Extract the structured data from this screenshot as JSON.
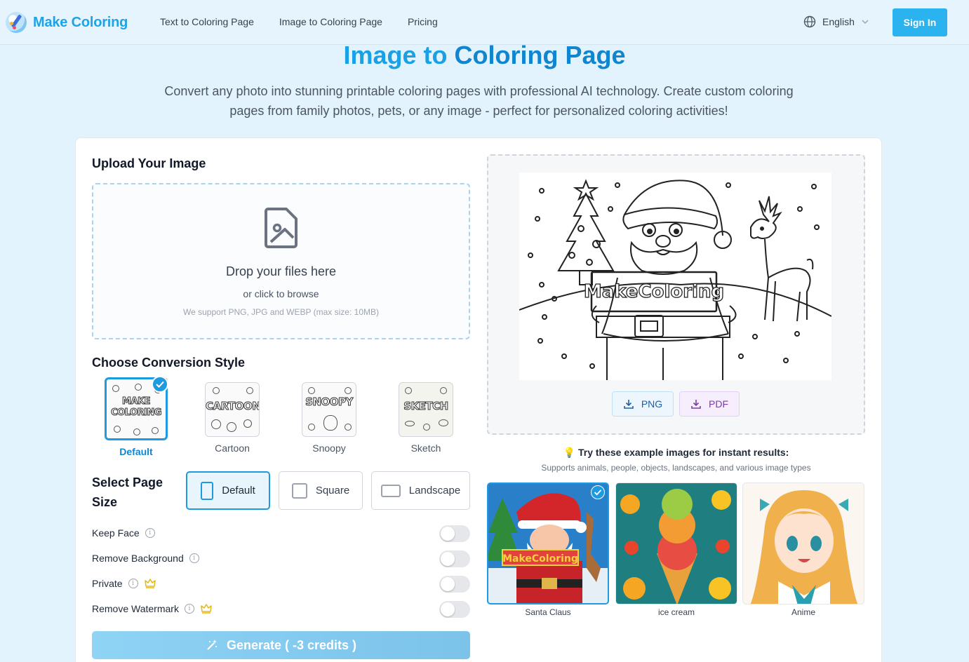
{
  "header": {
    "brand": "Make Coloring",
    "nav": [
      "Text to Coloring Page",
      "Image to Coloring Page",
      "Pricing"
    ],
    "language": "English",
    "sign_in": "Sign In"
  },
  "hero": {
    "title_part1": "Image to",
    "title_part2": "Coloring Page",
    "subtitle": "Convert any photo into stunning printable coloring pages with professional AI technology. Create custom coloring pages from family photos, pets, or any image - perfect for personalized coloring activities!"
  },
  "upload": {
    "section_title": "Upload Your Image",
    "drop_text": "Drop your files here",
    "click_text": "or click to browse",
    "support_text": "We support PNG, JPG and WEBP (max size: 10MB)"
  },
  "style": {
    "section_title": "Choose Conversion Style",
    "options": [
      {
        "label": "Default",
        "thumb_word": "MAKE COLORING",
        "selected": true
      },
      {
        "label": "Cartoon",
        "thumb_word": "CARTOON",
        "selected": false
      },
      {
        "label": "Snoopy",
        "thumb_word": "SNOOPY",
        "selected": false
      },
      {
        "label": "Sketch",
        "thumb_word": "SKETCH",
        "selected": false
      }
    ]
  },
  "page_size": {
    "section_title": "Select Page Size",
    "options": [
      {
        "label": "Default",
        "selected": true
      },
      {
        "label": "Square",
        "selected": false
      },
      {
        "label": "Landscape",
        "selected": false
      }
    ]
  },
  "toggles": [
    {
      "label": "Keep Face",
      "info": true,
      "premium": false,
      "on": false
    },
    {
      "label": "Remove Background",
      "info": true,
      "premium": false,
      "on": false
    },
    {
      "label": "Private",
      "info": true,
      "premium": true,
      "on": false
    },
    {
      "label": "Remove Watermark",
      "info": true,
      "premium": true,
      "on": false
    }
  ],
  "generate": {
    "label": "Generate ( -3 credits )"
  },
  "preview": {
    "sign_text": "MakeColoring",
    "download_png": "PNG",
    "download_pdf": "PDF"
  },
  "examples": {
    "title": "Try these example images for instant results:",
    "subtitle": "Supports animals, people, objects, landscapes, and various image types",
    "items": [
      {
        "label": "Santa Claus",
        "selected": true
      },
      {
        "label": "ice cream",
        "selected": false
      },
      {
        "label": "Anime",
        "selected": false
      }
    ]
  },
  "colors": {
    "accent": "#1e9be0",
    "brand": "#1ea3e8",
    "background": "#e3f3fd",
    "premium": "#e5b816"
  }
}
